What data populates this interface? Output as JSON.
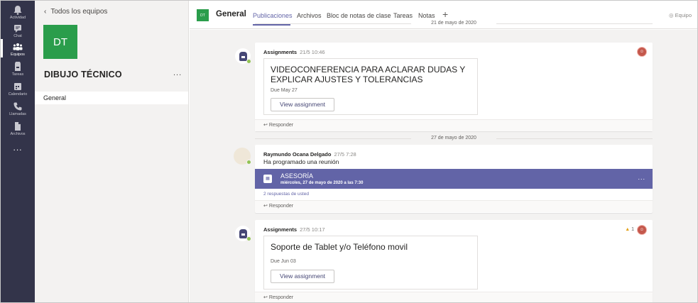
{
  "rail": {
    "items": [
      {
        "label": "Actividad",
        "icon": "bell-icon"
      },
      {
        "label": "Chat",
        "icon": "chat-icon"
      },
      {
        "label": "Equipos",
        "icon": "teams-icon"
      },
      {
        "label": "Tareas",
        "icon": "assignments-icon"
      },
      {
        "label": "Calendario",
        "icon": "calendar-icon"
      },
      {
        "label": "Llamadas",
        "icon": "phone-icon"
      },
      {
        "label": "Archivos",
        "icon": "files-icon"
      }
    ],
    "more": "...",
    "active": "Equipos"
  },
  "team": {
    "back_label": "Todos los equipos",
    "tile": "DT",
    "name": "DIBUJO TÉCNICO",
    "more": "...",
    "channels": [
      "General"
    ]
  },
  "header": {
    "logo": "DT",
    "title": "General",
    "tabs": [
      "Publicaciones",
      "Archivos",
      "Bloc de notas de clase",
      "Tareas",
      "Notas"
    ],
    "add": "+",
    "right": "Equipo"
  },
  "feed": {
    "posts": [
      {
        "date": "21 de mayo de 2020",
        "author": "Assignments",
        "time": "21/5 10:46",
        "title": "VIDEOCONFERENCIA PARA ACLARAR DUDAS Y EXPLICAR AJUSTES Y TOLERANCIAS",
        "due": "Due May 27",
        "button": "View assignment",
        "reply": "Responder"
      },
      {
        "date": "27 de mayo de 2020",
        "author": "Raymundo Ocana Delgado",
        "time": "27/5 7:28",
        "text": "Ha programado una reunión",
        "meeting_title": "ASESORÍA",
        "meeting_sub": "miércoles, 27 de mayo de 2020 a las 7:30",
        "replies": "2 respuestas de usted",
        "reply": "Responder"
      },
      {
        "author": "Assignments",
        "time": "27/5 10:17",
        "title": "Soporte de Tablet y/o Teléfono movil",
        "due": "Due Jun 03",
        "button": "View assignment",
        "likes": "1",
        "reply": "Responder"
      }
    ]
  },
  "colors": {
    "rail": "#33344a",
    "accent": "#6264a7",
    "team": "#2a9d4b"
  }
}
